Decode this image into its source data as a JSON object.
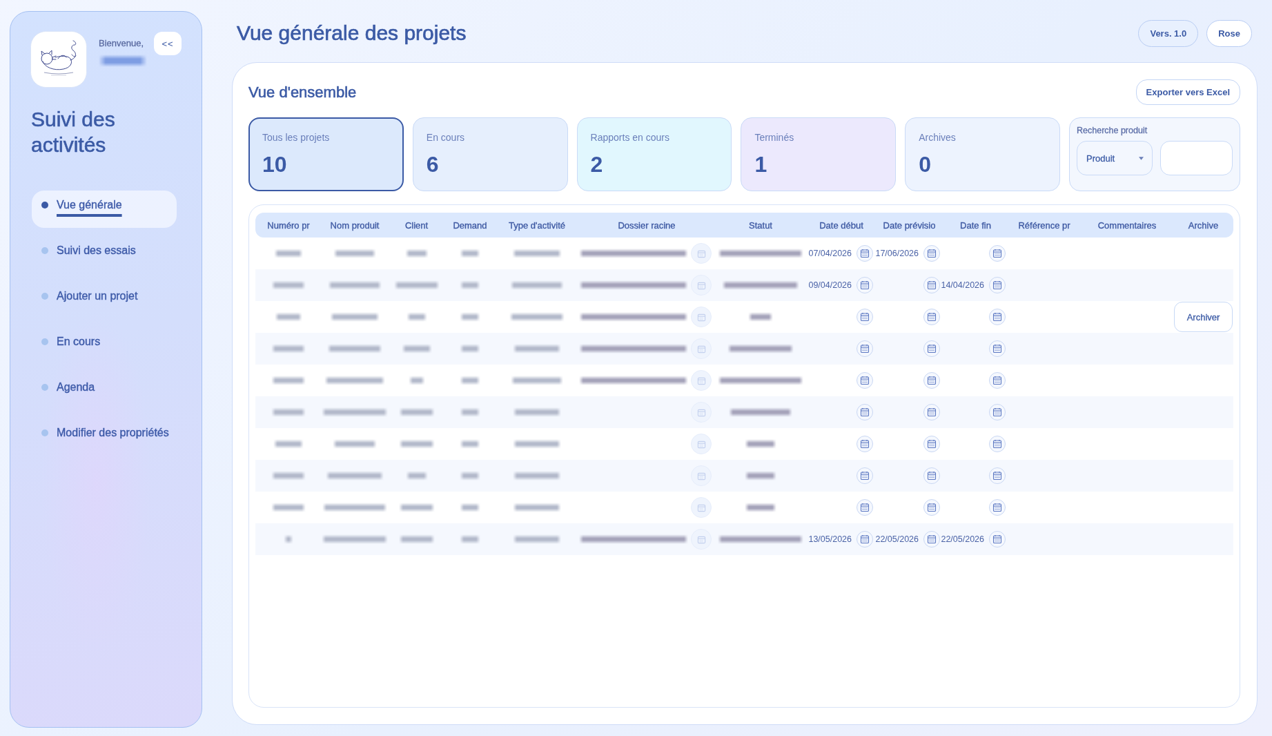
{
  "sidebar": {
    "greeting": "Bienvenue,",
    "user": {
      "redacted": true
    },
    "collapse_button": "<<",
    "title": "Suivi des activités",
    "nav": [
      {
        "label": "Vue générale",
        "selected": true
      },
      {
        "label": "Suivi des essais",
        "selected": false
      },
      {
        "label": "Ajouter un projet",
        "selected": false
      },
      {
        "label": "En cours",
        "selected": false
      },
      {
        "label": "Agenda",
        "selected": false
      },
      {
        "label": "Modifier des propriétés",
        "selected": false
      }
    ]
  },
  "header": {
    "title": "Vue générale des projets",
    "buttons": [
      {
        "label": "Vers. 1.0",
        "kind": "outline"
      },
      {
        "label": "Rose",
        "kind": "plain"
      }
    ]
  },
  "overview": {
    "title": "Vue d'ensemble",
    "export_button": "Exporter vers Excel",
    "stats": [
      {
        "label": "Tous les projets",
        "value": "10",
        "selected": true,
        "color": "#dce9fc"
      },
      {
        "label": "En cours",
        "value": "6",
        "selected": false,
        "color": "#e6effd"
      },
      {
        "label": "Rapports en cours",
        "value": "2",
        "selected": false,
        "color": "#e1f7fe"
      },
      {
        "label": "Terminés",
        "value": "1",
        "selected": false,
        "color": "#ece9fd"
      },
      {
        "label": "Archives",
        "value": "0",
        "selected": false,
        "color": "#edf3fe"
      }
    ],
    "search": {
      "label": "Recherche produit",
      "dropdown": "Produit"
    }
  },
  "table": {
    "columns": [
      "Numéro pr",
      "Nom produit",
      "Client",
      "Demand",
      "Type d'activité",
      "Dossier racine",
      "Statut",
      "Date début",
      "Date prévisio",
      "Date fin",
      "Référence pr",
      "Commentaires",
      "Archive"
    ],
    "rows": [
      {
        "redacted": {
          "numero": true,
          "nom": true,
          "client": true,
          "demandeur": true,
          "type": true,
          "dossier": true,
          "statut": true
        },
        "date_debut": "07/04/2026",
        "date_prevision": "17/06/2026"
      },
      {
        "redacted": {
          "numero": true,
          "nom": true,
          "client": true,
          "demandeur": true,
          "type": true,
          "dossier": true,
          "statut": true
        },
        "date_debut": "09/04/2026",
        "date_fin": "14/04/2026"
      },
      {
        "redacted": {
          "numero": true,
          "nom": true,
          "client": true,
          "demandeur": true,
          "type": true,
          "dossier": true,
          "statut": true
        },
        "archive_button": "Archiver"
      },
      {
        "redacted": {
          "numero": true,
          "nom": true,
          "client": true,
          "demandeur": true,
          "type": true,
          "dossier": true,
          "statut": true
        }
      },
      {
        "redacted": {
          "numero": true,
          "nom": true,
          "client": true,
          "demandeur": true,
          "type": true,
          "dossier": true,
          "statut": true
        }
      },
      {
        "redacted": {
          "numero": true,
          "nom": true,
          "client": true,
          "demandeur": true,
          "type": true,
          "dossier": false,
          "statut": true
        }
      },
      {
        "redacted": {
          "numero": true,
          "nom": true,
          "client": true,
          "demandeur": true,
          "type": true,
          "dossier": false,
          "statut": true
        }
      },
      {
        "redacted": {
          "numero": true,
          "nom": true,
          "client": true,
          "demandeur": true,
          "type": true,
          "dossier": false,
          "statut": true
        }
      },
      {
        "redacted": {
          "numero": true,
          "nom": true,
          "client": true,
          "demandeur": true,
          "type": true,
          "dossier": false,
          "statut": true
        }
      },
      {
        "redacted": {
          "numero": true,
          "nom": true,
          "client": true,
          "demandeur": true,
          "type": true,
          "dossier": true,
          "statut": true
        },
        "date_debut": "13/05/2026",
        "date_prevision": "22/05/2026",
        "date_fin": "22/05/2026"
      }
    ]
  }
}
